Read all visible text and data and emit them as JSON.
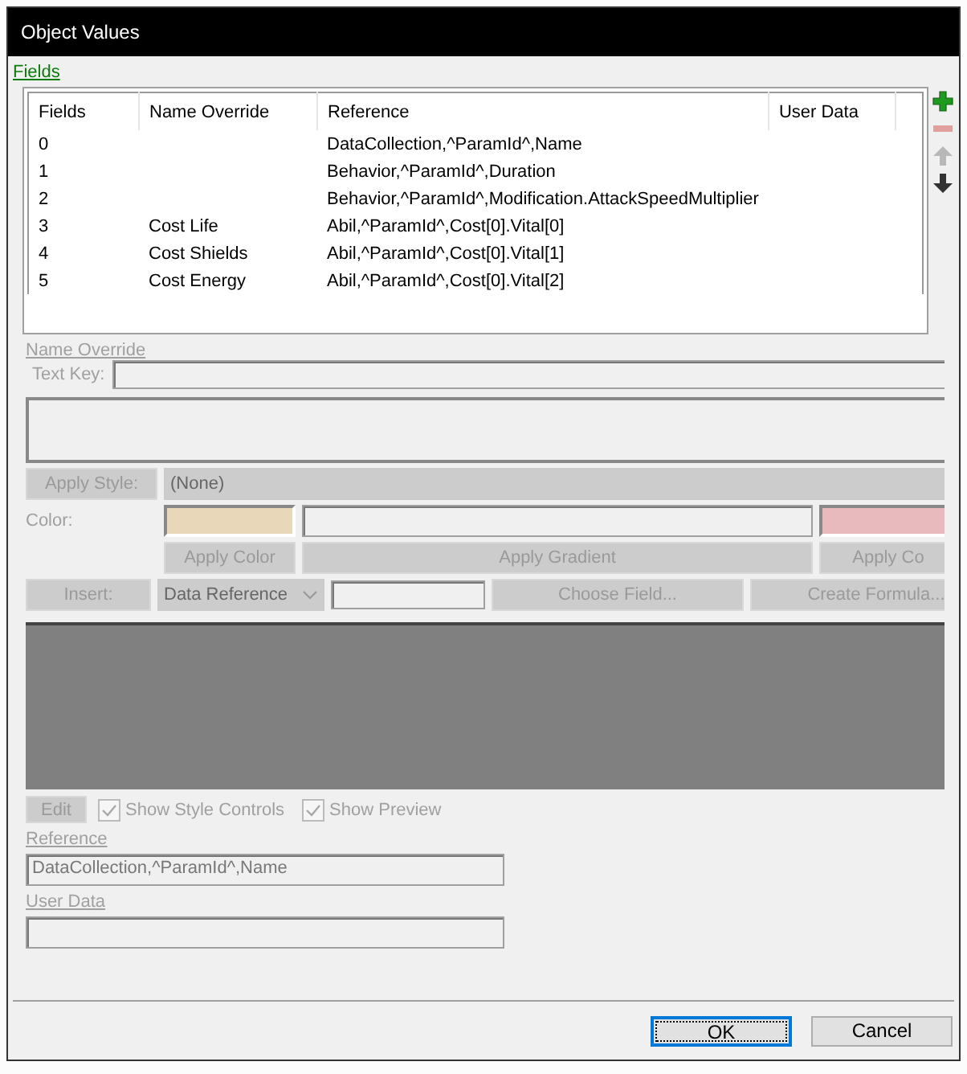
{
  "window": {
    "title": "Object Values"
  },
  "fields_link": "Fields",
  "table": {
    "columns": [
      "Fields",
      "Name Override",
      "Reference",
      "User Data"
    ],
    "rows": [
      {
        "field": "0",
        "reference": "DataCollection,^ParamId^,Name"
      },
      {
        "field": "1",
        "reference": "Behavior,^ParamId^,Duration"
      },
      {
        "field": "2",
        "reference": "Behavior,^ParamId^,Modification.AttackSpeedMultiplier"
      },
      {
        "field": "3",
        "name_override": "Cost Life",
        "reference": "Abil,^ParamId^,Cost[0].Vital[0]"
      },
      {
        "field": "4",
        "name_override": "Cost Shields",
        "reference": "Abil,^ParamId^,Cost[0].Vital[1]"
      },
      {
        "field": "5",
        "name_override": "Cost Energy",
        "reference": "Abil,^ParamId^,Cost[0].Vital[2]"
      }
    ]
  },
  "side_buttons": [
    {
      "kind": "add",
      "disabled": false
    },
    {
      "kind": "remove",
      "disabled": true
    },
    {
      "kind": "up",
      "disabled": true
    },
    {
      "kind": "down",
      "disabled": false
    }
  ],
  "name_override": {
    "label": "Name Override",
    "text_key_label": "Text Key:",
    "disabled": true,
    "apply_style_button": "Apply Style:",
    "style_value": "(None)",
    "color_label": "Color:",
    "color_swatches": [
      {
        "color": "#e8d7b9"
      },
      {
        "color": "#e8b9bd"
      }
    ],
    "apply_color_button": "Apply Color",
    "apply_gradient_button": "Apply Gradient",
    "apply_color_end_button": "Apply Co",
    "insert_button": "Insert:",
    "insert_type": "Data Reference",
    "choose_field_button": "Choose Field...",
    "create_formula_button": "Create Formula...",
    "edit_button": "Edit",
    "options": [
      {
        "label": "Show Style Controls",
        "checked": true
      },
      {
        "label": "Show Preview",
        "checked": true
      }
    ]
  },
  "reference": {
    "label": "Reference",
    "value": "DataCollection,^ParamId^,Name"
  },
  "user_data": {
    "label": "User Data"
  },
  "buttons": [
    {
      "label": "OK",
      "default": true
    },
    {
      "label": "Cancel",
      "default": false
    }
  ]
}
